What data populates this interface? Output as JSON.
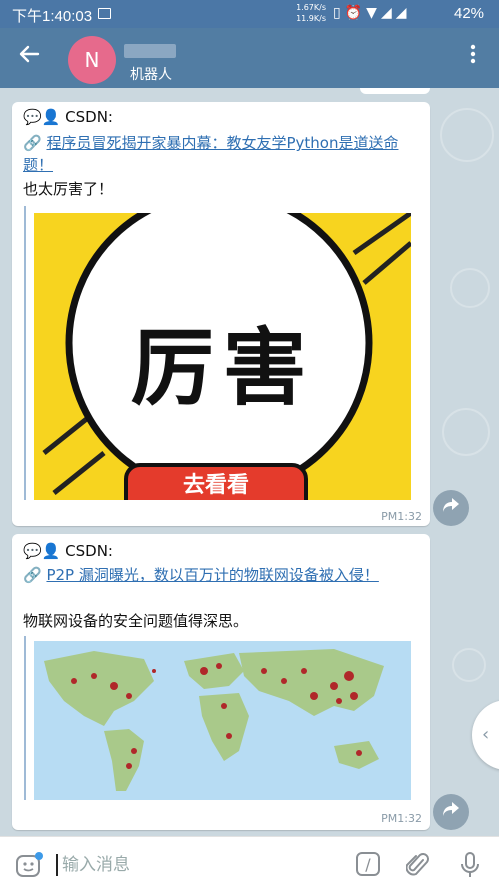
{
  "status_bar": {
    "time": "下午1:40:03",
    "speed_up": "1.67K/s",
    "speed_down": "11.9K/s",
    "battery": "42%"
  },
  "app_bar": {
    "avatar_letter": "N",
    "subtitle": "机器人"
  },
  "messages": [
    {
      "source": "CSDN:",
      "link_text": "程序员冒死揭开家暴内幕：教女友学Python是道送命题！",
      "body": "也太厉害了！",
      "image_text_main": "厉害",
      "image_text_button": "去看看",
      "time": "PM1:32"
    },
    {
      "source": "CSDN:",
      "link_text": "P2P 漏洞曝光，数以百万计的物联网设备被入侵！",
      "body": "物联网设备的安全问题值得深思。",
      "time": "PM1:32"
    }
  ],
  "composer": {
    "placeholder": "输入消息",
    "command_symbol": "/"
  }
}
